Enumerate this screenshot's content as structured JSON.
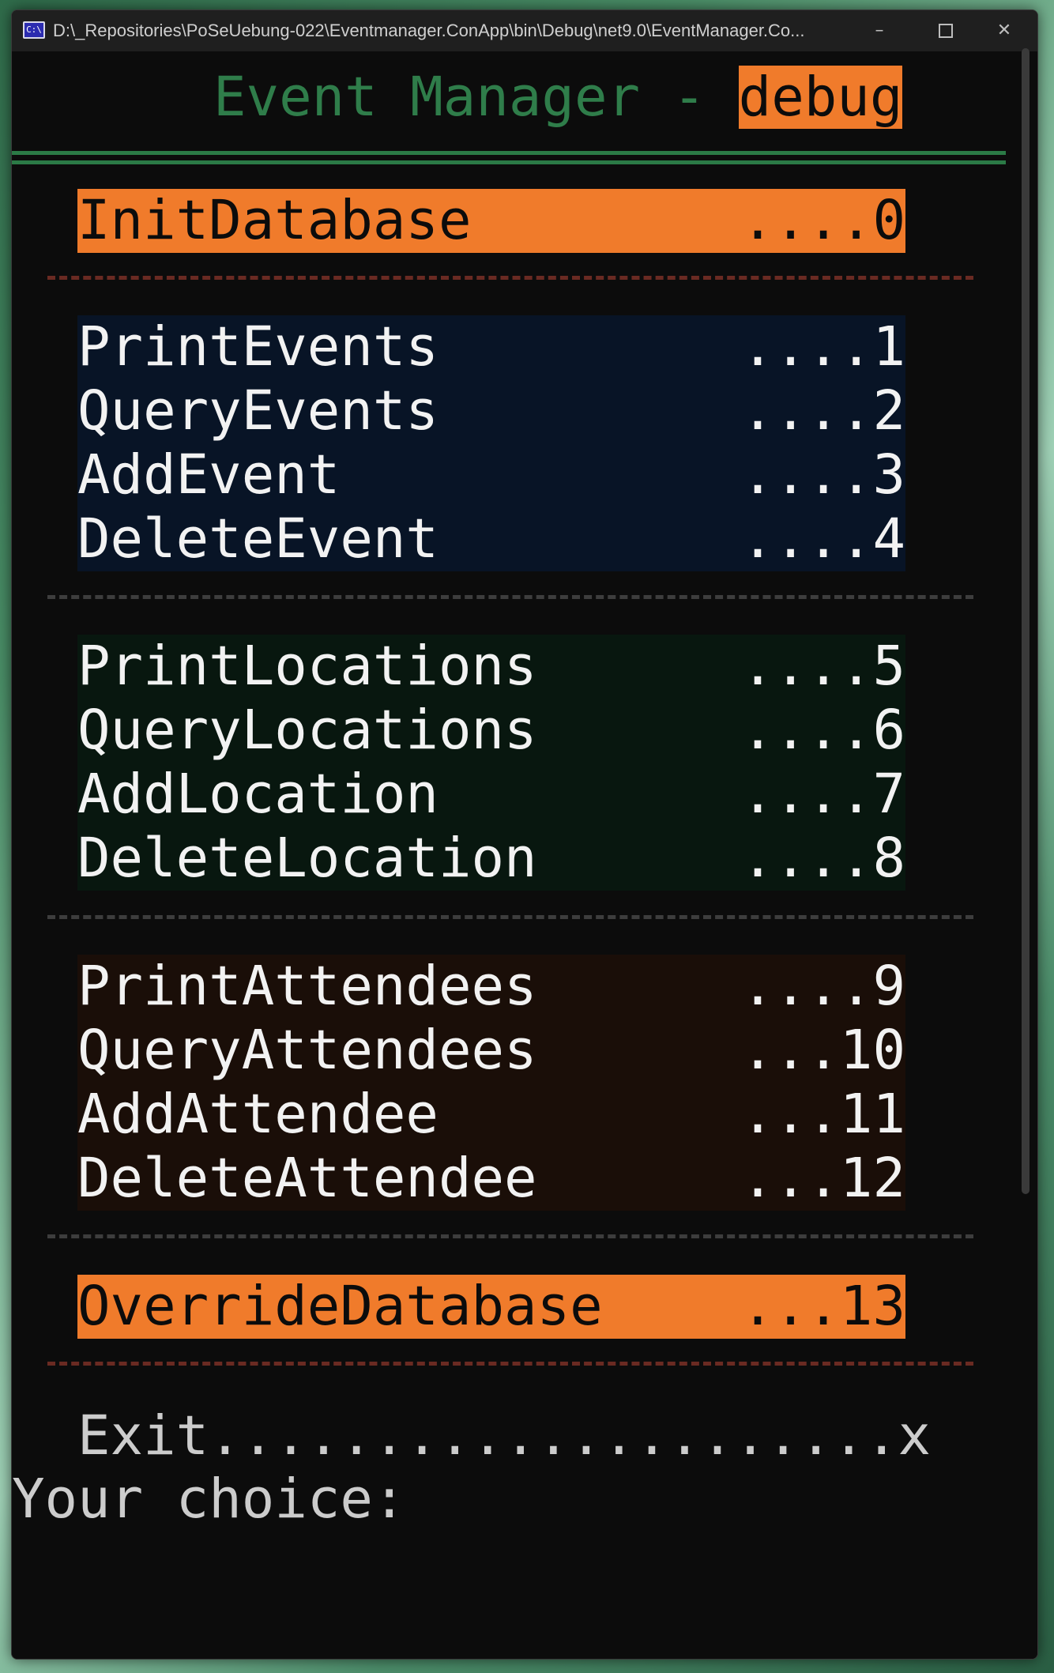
{
  "window": {
    "title": "D:\\_Repositories\\PoSeUebung-022\\Eventmanager.ConApp\\bin\\Debug\\net9.0\\EventManager.Co...",
    "icon": "C:\\",
    "minimize_glyph": "–",
    "close_glyph": "✕"
  },
  "header": {
    "title": "Event Manager - ",
    "badge": "debug"
  },
  "menu": {
    "init": {
      "label": "InitDatabase",
      "number": "....0"
    },
    "events": [
      {
        "label": "PrintEvents",
        "number": "....1"
      },
      {
        "label": "QueryEvents",
        "number": "....2"
      },
      {
        "label": "AddEvent",
        "number": "....3"
      },
      {
        "label": "DeleteEvent",
        "number": "....4"
      }
    ],
    "locations": [
      {
        "label": "PrintLocations",
        "number": "....5"
      },
      {
        "label": "QueryLocations",
        "number": "....6"
      },
      {
        "label": "AddLocation",
        "number": "....7"
      },
      {
        "label": "DeleteLocation",
        "number": "....8"
      }
    ],
    "attendees": [
      {
        "label": "PrintAttendees",
        "number": "....9"
      },
      {
        "label": "QueryAttendees",
        "number": "...10"
      },
      {
        "label": "AddAttendee",
        "number": "...11"
      },
      {
        "label": "DeleteAttendee",
        "number": "...12"
      }
    ],
    "override": {
      "label": "OverrideDatabase",
      "number": "...13"
    },
    "exit": "Exit.....................x"
  },
  "prompt": "Your choice:",
  "colors": {
    "orange": "#f07b2b",
    "green": "#2f7d4a",
    "background": "#0c0c0c"
  }
}
